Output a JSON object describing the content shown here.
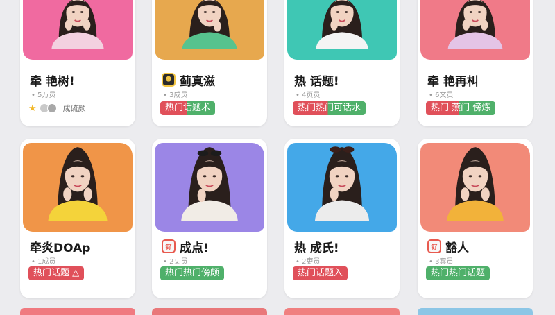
{
  "cards": [
    {
      "title": "牵 艳树!",
      "members": "• 5万员",
      "tag": "成硫颜",
      "tag_style": "plain",
      "icon": "",
      "bg": "#f06aa0",
      "shirt": "#f3d1e0"
    },
    {
      "title": "蓟真滋",
      "members": "• 3成员",
      "tag": "热门话题术",
      "tag_style": "mix",
      "icon": "☻",
      "icon_style": "yellow",
      "bg": "#e7a84e",
      "shirt": "#57c38e"
    },
    {
      "title": "热 话题!",
      "members": "• 4页员",
      "tag": "热门热门可话水",
      "tag_style": "mix",
      "icon": "",
      "bg": "#3fc7b4",
      "shirt": "#f4f4f4"
    },
    {
      "title": "牵 艳再朻",
      "members": "• 6文员",
      "tag": "热门 燕门 傍炼",
      "tag_style": "mix",
      "icon": "",
      "bg": "#f07a88",
      "shirt": "#e4c4e6"
    },
    {
      "title": "牵炎DOAp",
      "members": "• 1成员",
      "tag": "热门话题 △",
      "tag_style": "red",
      "icon": "",
      "bg": "#f09548",
      "shirt": "#f4d33a"
    },
    {
      "title": "成点!",
      "members": "• 2丈员",
      "tag": "热门热门傍颇",
      "tag_style": "green",
      "icon": "钌",
      "icon_style": "red",
      "bg": "#9b86e6",
      "shirt": "#f1ece6"
    },
    {
      "title": "热 成氏!",
      "members": "• 2吏员",
      "tag": "热门话题入",
      "tag_style": "red",
      "icon": "",
      "bg": "#44a8e8",
      "shirt": "#ececec"
    },
    {
      "title": "豁人",
      "members": "• 3宾员",
      "tag": "热门热门话题",
      "tag_style": "green",
      "icon": "钌",
      "icon_style": "red",
      "bg": "#f28a78",
      "shirt": "#f2b23a"
    }
  ],
  "bottom_colors": [
    "#f07a80",
    "#e9787a",
    "#f08080",
    "#8cc6e6"
  ]
}
